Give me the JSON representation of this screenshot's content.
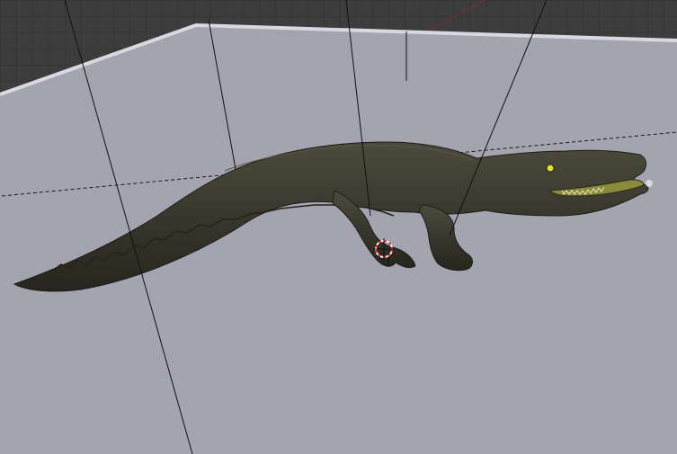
{
  "viewport": {
    "kind": "3d-viewport",
    "background_grid_color": "#3d3d3d",
    "ground_plane_color": "#a4a3b0",
    "plane_edge_color": "#d6d6de",
    "model": {
      "name": "crocodile",
      "body_color": "#35352b",
      "eye_color": "#e6e61a",
      "mouth_color": "#8b8a3a"
    },
    "cursor_3d": {
      "icon": "3d-cursor-icon",
      "ring_color_a": "#ff2b2b",
      "ring_color_b": "#ffffff"
    }
  }
}
